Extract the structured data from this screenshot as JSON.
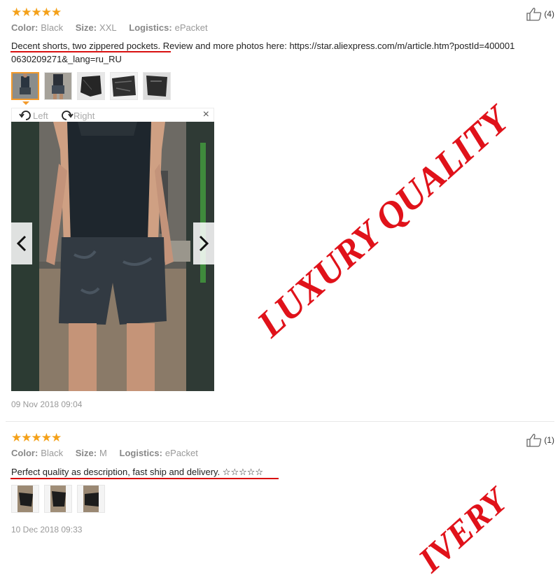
{
  "reviews": [
    {
      "rating": "★★★★★",
      "color_label": "Color:",
      "color_value": "Black",
      "size_label": "Size:",
      "size_value": "XXL",
      "logistics_label": "Logistics:",
      "logistics_value": "ePacket",
      "helpful_count": "(4)",
      "text_highlight": "Decent shorts, two zippered pockets.",
      "text_rest": " Review and more photos here: https://star.aliexpress.com/m/article.htm?postId=4000010630209271&_lang=ru_RU",
      "viewer": {
        "rotate_left": "Left",
        "rotate_right": "Right",
        "close": "×"
      },
      "date": "09 Nov 2018 09:04"
    },
    {
      "rating": "★★★★★",
      "color_label": "Color:",
      "color_value": "Black",
      "size_label": "Size:",
      "size_value": "M",
      "logistics_label": "Logistics:",
      "logistics_value": "ePacket",
      "helpful_count": "(1)",
      "text_highlight": "Perfect quality as description, fast ship and delivery. ☆☆☆☆☆",
      "date": "10 Dec 2018 09:33"
    }
  ],
  "watermarks": {
    "main": "LUXURY QUALITY",
    "partial": "IVERY"
  },
  "colors": {
    "star": "#f4a11a",
    "accent": "#d81010",
    "thumb_border": "#f39a2b"
  }
}
